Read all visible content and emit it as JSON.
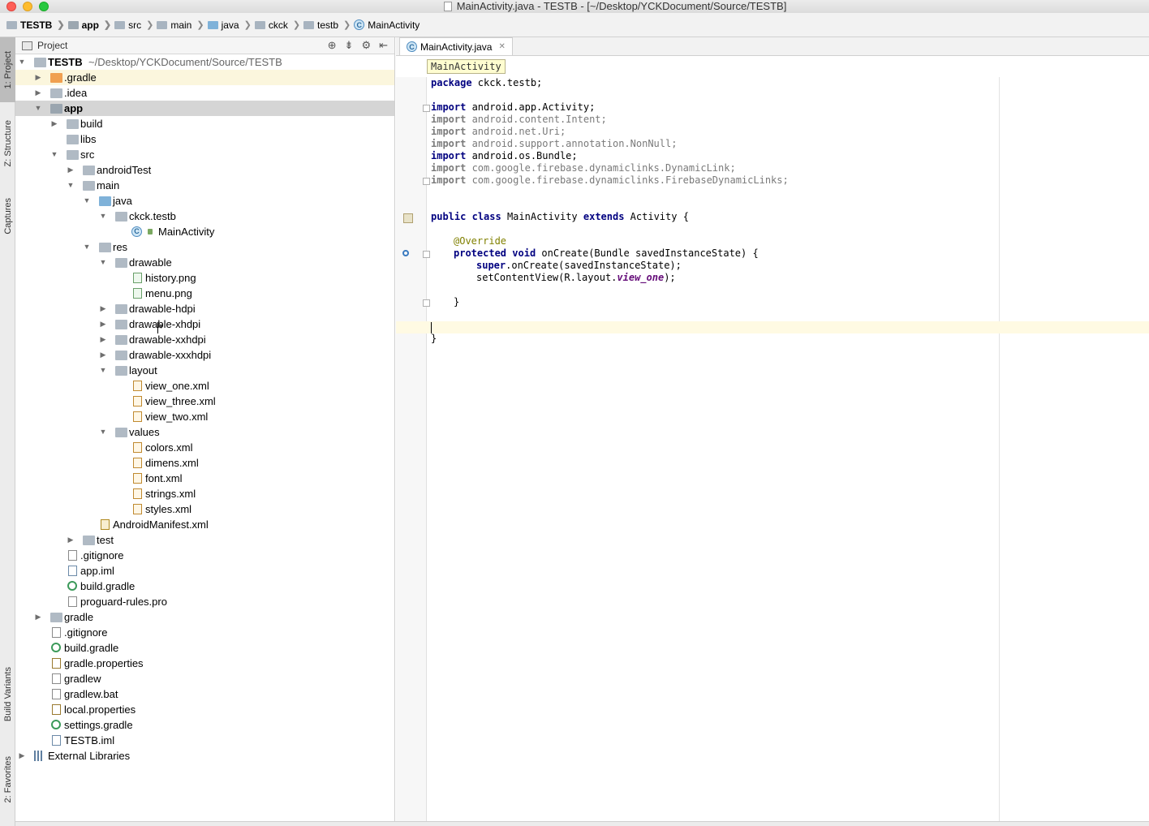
{
  "window": {
    "title": "MainActivity.java - TESTB - [~/Desktop/YCKDocument/Source/TESTB]"
  },
  "breadcrumbs": [
    "TESTB",
    "app",
    "src",
    "main",
    "java",
    "ckck",
    "testb",
    "MainActivity"
  ],
  "left_tool_tabs": [
    "1: Project",
    "Z: Structure",
    "Captures",
    "Build Variants",
    "2: Favorites"
  ],
  "project_panel": {
    "title": "Project",
    "root_label": "TESTB",
    "root_path": "~/Desktop/YCKDocument/Source/TESTB",
    "tree": [
      {
        "label": ".gradle"
      },
      {
        "label": ".idea"
      },
      {
        "label": "app"
      },
      {
        "label": "build"
      },
      {
        "label": "libs"
      },
      {
        "label": "src"
      },
      {
        "label": "androidTest"
      },
      {
        "label": "main"
      },
      {
        "label": "java"
      },
      {
        "label": "ckck.testb"
      },
      {
        "label": "MainActivity"
      },
      {
        "label": "res"
      },
      {
        "label": "drawable"
      },
      {
        "label": "history.png"
      },
      {
        "label": "menu.png"
      },
      {
        "label": "drawable-hdpi"
      },
      {
        "label": "drawable-xhdpi"
      },
      {
        "label": "drawable-xxhdpi"
      },
      {
        "label": "drawable-xxxhdpi"
      },
      {
        "label": "layout"
      },
      {
        "label": "view_one.xml"
      },
      {
        "label": "view_three.xml"
      },
      {
        "label": "view_two.xml"
      },
      {
        "label": "values"
      },
      {
        "label": "colors.xml"
      },
      {
        "label": "dimens.xml"
      },
      {
        "label": "font.xml"
      },
      {
        "label": "strings.xml"
      },
      {
        "label": "styles.xml"
      },
      {
        "label": "AndroidManifest.xml"
      },
      {
        "label": "test"
      },
      {
        "label": ".gitignore"
      },
      {
        "label": "app.iml"
      },
      {
        "label": "build.gradle"
      },
      {
        "label": "proguard-rules.pro"
      },
      {
        "label": "gradle"
      },
      {
        "label": ".gitignore"
      },
      {
        "label": "build.gradle"
      },
      {
        "label": "gradle.properties"
      },
      {
        "label": "gradlew"
      },
      {
        "label": "gradlew.bat"
      },
      {
        "label": "local.properties"
      },
      {
        "label": "settings.gradle"
      },
      {
        "label": "TESTB.iml"
      },
      {
        "label": "External Libraries"
      }
    ]
  },
  "editor": {
    "tab_label": "MainActivity.java",
    "class_crumb": "MainActivity",
    "code": {
      "l1_kw": "package",
      "l1_rest": " ckck.testb;",
      "imp_kw": "import",
      "i1": " android.app.Activity;",
      "i2": " android.content.Intent;",
      "i3": " android.net.Uri;",
      "i4": " android.support.annotation.NonNull;",
      "i5": " android.os.Bundle;",
      "i6": " com.google.firebase.dynamiclinks.DynamicLink;",
      "i7": " com.google.firebase.dynamiclinks.FirebaseDynamicLinks;",
      "c_public": "public",
      "c_class": "class",
      "c_name": " MainActivity ",
      "c_extends": "extends",
      "c_rest": " Activity {",
      "override": "@Override",
      "m_protected": "protected",
      "m_void": "void",
      "m_rest": " onCreate(Bundle savedInstanceState) {",
      "s_super": "super",
      "s_rest": ".onCreate(savedInstanceState);",
      "scv_a": "setContentView(R.layout.",
      "scv_b": "view_one",
      "scv_c": ");",
      "close_method": "}",
      "close_class": "}"
    }
  }
}
